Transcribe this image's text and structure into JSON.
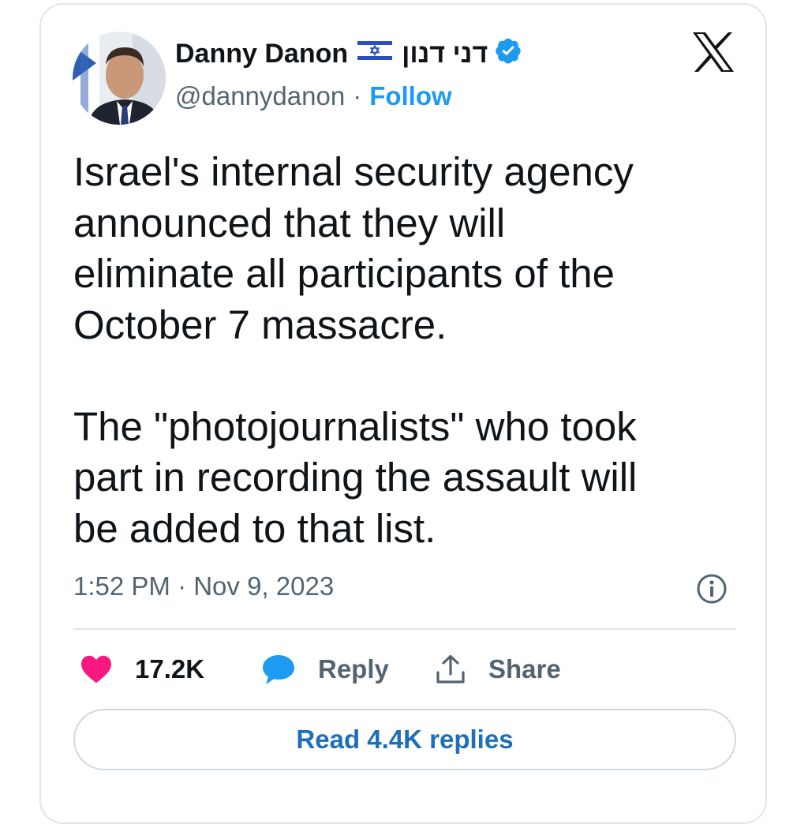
{
  "author": {
    "display_name": "Danny Danon",
    "flag_icon": "israel-flag-icon",
    "hebrew_name": "דני דנון",
    "verified_icon": "verified-badge-icon",
    "handle": "@dannydanon",
    "separator": "·",
    "follow_label": "Follow"
  },
  "platform_icon": "x-logo-icon",
  "tweet": {
    "text": "Israel's internal security agency\nannounced that they will\neliminate all participants of the\nOctober 7 massacre.\n\nThe \"photojournalists\" who took\npart in recording the assault will\nbe added to that list.",
    "timestamp": "1:52 PM · Nov 9, 2023",
    "info_icon": "info-icon"
  },
  "actions": {
    "likes_count": "17.2K",
    "like_icon": "heart-icon",
    "reply_label": "Reply",
    "reply_icon": "speech-bubble-icon",
    "share_label": "Share",
    "share_icon": "share-upload-icon"
  },
  "read_replies_label": "Read 4.4K replies",
  "colors": {
    "accent_blue": "#1d9bf0",
    "like_pink": "#f91880",
    "text_dark": "#0f1419",
    "text_gray": "#536471",
    "border": "#e1e6ea"
  }
}
